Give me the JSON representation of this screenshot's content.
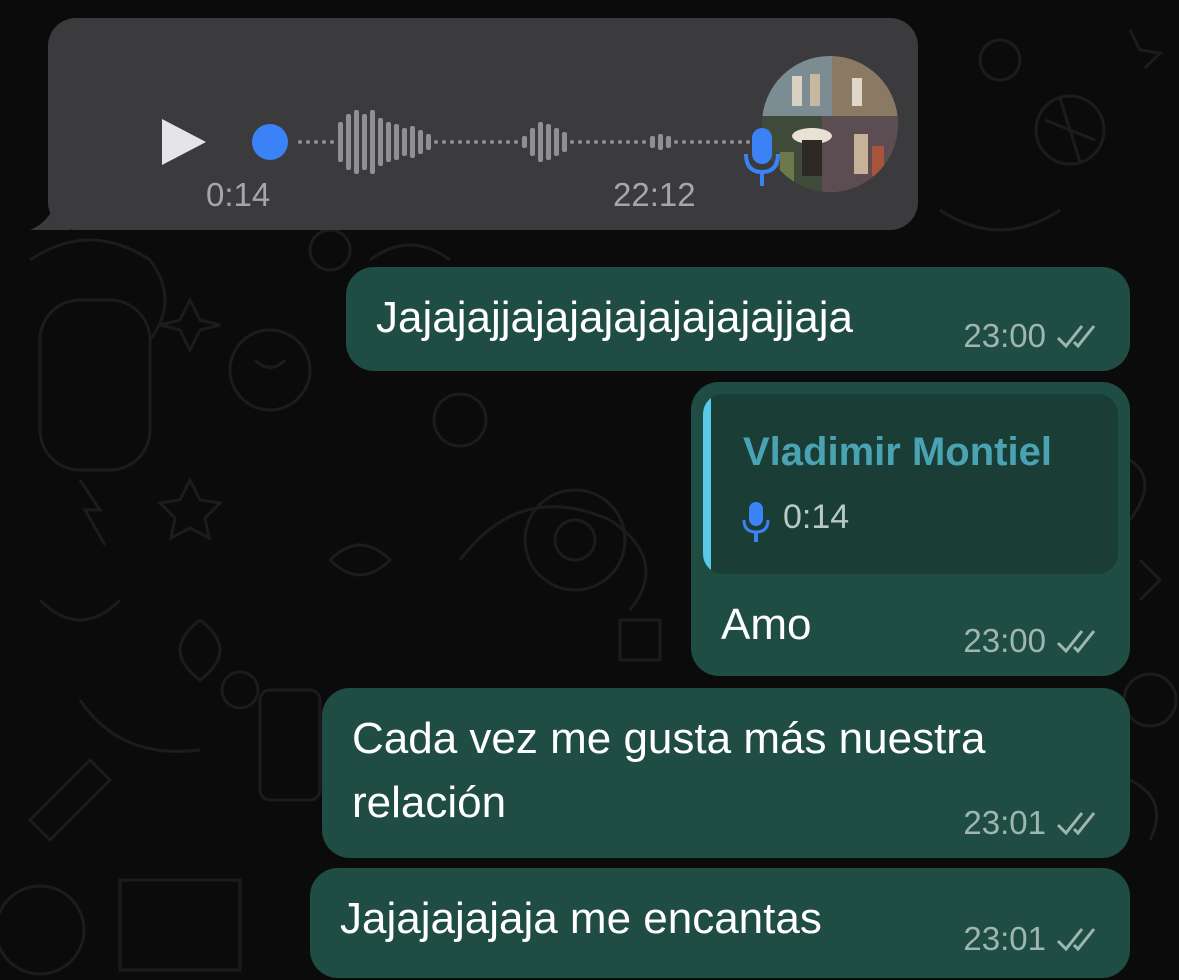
{
  "colors": {
    "incoming_bubble": "#3b3b3d",
    "outgoing_bubble": "#1f4d43",
    "accent_blue": "#3b82f6",
    "quote_name": "#4aa3b3",
    "read_ticks": "#9fb6b0"
  },
  "voice_note": {
    "duration": "0:14",
    "time": "22:12",
    "icons": [
      "play-icon",
      "mic-icon",
      "sender-avatar"
    ],
    "playback_progress": 0.0
  },
  "messages": [
    {
      "text": "Jajajajjajajajajajajajajjaja",
      "time": "23:00",
      "status": "read"
    },
    {
      "quote": {
        "sender": "Vladimir Montiel",
        "duration": "0:14",
        "icon": "mic-icon"
      },
      "text": "Amo",
      "time": "23:00",
      "status": "read"
    },
    {
      "line1": "Cada vez me gusta más nuestra",
      "line2": "relación",
      "time": "23:01",
      "status": "read"
    },
    {
      "text": "Jajajajajaja me encantas",
      "time": "23:01",
      "status": "read"
    }
  ]
}
